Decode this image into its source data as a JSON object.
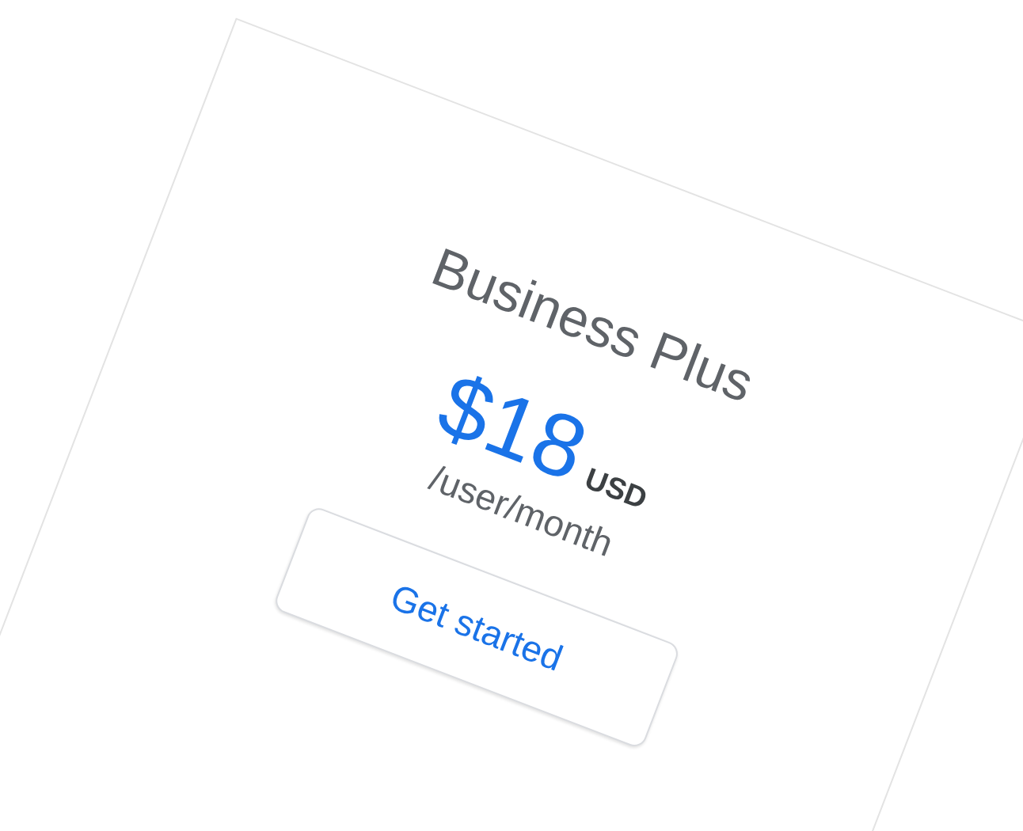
{
  "plan": {
    "title": "Business Plus",
    "price": "$18",
    "currency": "USD",
    "period": "/user/month",
    "button": "Get started"
  }
}
